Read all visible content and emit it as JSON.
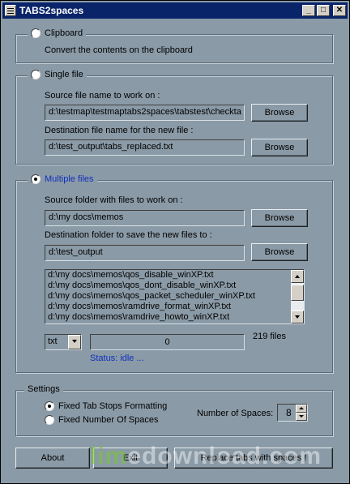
{
  "window": {
    "title": "TABS2spaces",
    "minimize_glyph": "_",
    "maximize_glyph": "□",
    "close_glyph": "✕"
  },
  "clipboard": {
    "label": "Clipboard",
    "description": "Convert the contents on the clipboard",
    "selected": false
  },
  "single_file": {
    "label": "Single file",
    "selected": false,
    "source_label": "Source file name to work on :",
    "source_value": "d:\\testmap\\testmaptabs2spaces\\tabstest\\checkta",
    "destination_label": "Destination file name for the new file :",
    "destination_value": "d:\\test_output\\tabs_replaced.txt",
    "browse_label": "Browse"
  },
  "multiple_files": {
    "label": "Multiple files",
    "selected": true,
    "label_color": "#1030c0",
    "source_label": "Source folder with files to work on :",
    "source_value": "d:\\my docs\\memos",
    "destination_label": "Destination folder to save the new files to :",
    "destination_value": "d:\\test_output",
    "browse_label": "Browse",
    "files": [
      "d:\\my docs\\memos\\qos_disable_winXP.txt",
      "d:\\my docs\\memos\\qos_dont_disable_winXP.txt",
      "d:\\my docs\\memos\\qos_packet_scheduler_winXP.txt",
      "d:\\my docs\\memos\\ramdrive_format_winXP.txt",
      "d:\\my docs\\memos\\ramdrive_howto_winXP.txt"
    ],
    "extension": "txt",
    "progress_value": "0",
    "file_count": "219 files",
    "status": "Status: idle ..."
  },
  "settings": {
    "label": "Settings",
    "option_fixed_tab_stops": "Fixed Tab Stops Formatting",
    "option_fixed_tab_stops_selected": true,
    "option_fixed_spaces": "Fixed Number Of Spaces",
    "option_fixed_spaces_selected": false,
    "spaces_label": "Number of Spaces:",
    "spaces_value": "8"
  },
  "footer": {
    "about_label": "About",
    "exit_label": "Exit",
    "replace_label": "Replace tabs with spaces !"
  },
  "watermark": {
    "part1": "lim",
    "part2": "edownload.com"
  },
  "colors": {
    "titlebar": "#0a246a",
    "background": "#8a9aa6",
    "accent_text": "#1030c0"
  }
}
